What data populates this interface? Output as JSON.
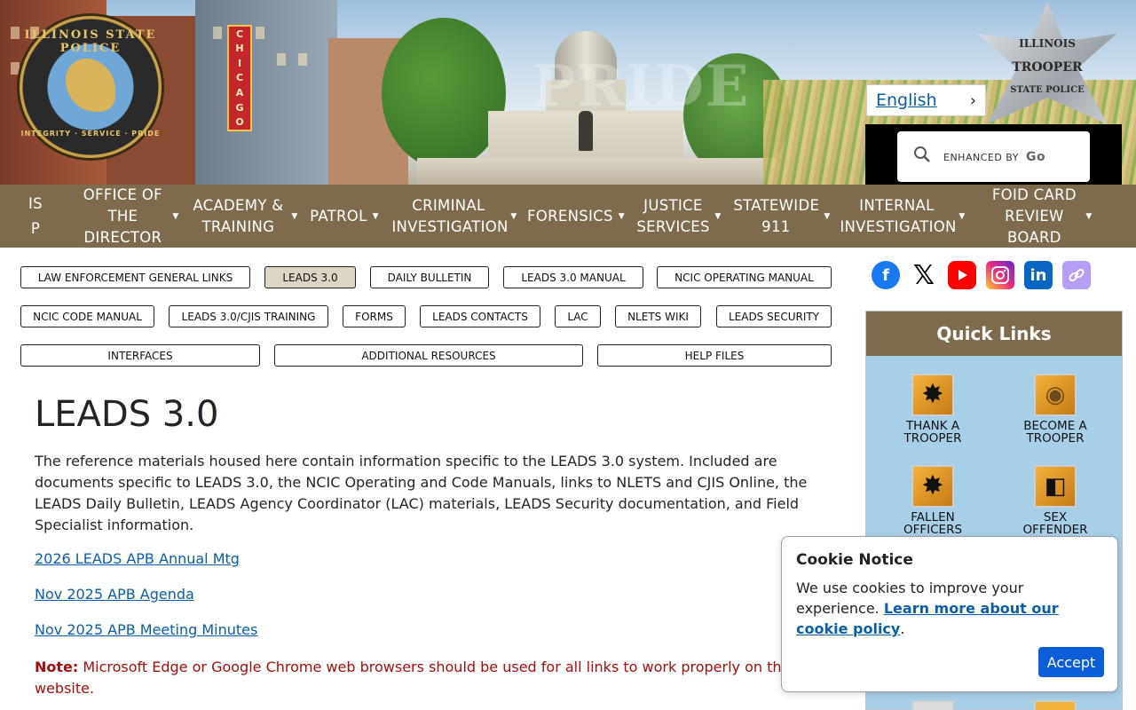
{
  "header": {
    "seal_top_text": "ILLINOIS STATE POLICE",
    "seal_bottom_text": "INTEGRITY · SERVICE · PRIDE",
    "marquee_text": "CHICAGO",
    "watermark_text": "PRIDE",
    "badge_lines": [
      "ILLINOIS",
      "TROOPER",
      "STATE POLICE"
    ],
    "language": {
      "label": "English",
      "icon": "chevron-right-icon"
    },
    "search": {
      "placeholder_prefix": "ENHANCED BY",
      "placeholder_brand": "Go",
      "icon": "search-icon"
    }
  },
  "nav": {
    "items": [
      {
        "label": "ISP",
        "display": "IS\nP",
        "has_caret": false
      },
      {
        "label": "OFFICE OF THE DIRECTOR",
        "has_caret": true
      },
      {
        "label": "ACADEMY & TRAINING",
        "has_caret": true
      },
      {
        "label": "PATROL",
        "has_caret": true
      },
      {
        "label": "CRIMINAL INVESTIGATION",
        "has_caret": true
      },
      {
        "label": "FORENSICS",
        "has_caret": true
      },
      {
        "label": "JUSTICE SERVICES",
        "has_caret": true
      },
      {
        "label": "STATEWIDE 911",
        "has_caret": true
      },
      {
        "label": "INTERNAL INVESTIGATION",
        "has_caret": true
      },
      {
        "label": "FOID CARD REVIEW BOARD",
        "has_caret": true
      }
    ]
  },
  "subnav": {
    "buttons": [
      "LAW ENFORCEMENT GENERAL LINKS",
      "LEADS 3.0",
      "DAILY BULLETIN",
      "LEADS 3.0 MANUAL",
      "NCIC OPERATING MANUAL",
      "NCIC CODE MANUAL",
      "LEADS 3.0/CJIS TRAINING",
      "FORMS",
      "LEADS CONTACTS",
      "LAC",
      "NLETS WIKI",
      "LEADS SECURITY",
      "INTERFACES",
      "ADDITIONAL RESOURCES",
      "HELP FILES"
    ],
    "active": "LEADS 3.0"
  },
  "main": {
    "title": "LEADS 3.0",
    "intro": "The reference materials housed here contain information specific to the LEADS 3.0 system. Included are documents specific to LEADS 3.0, the NCIC Operating and Code Manuals, links to NLETS and CJIS Online, the LEADS Daily Bulletin, LEADS Agency Coordinator (LAC) materials, LEADS Security documentation, and Field Specialist information.",
    "links": [
      "2026 LEADS APB Annual Mtg",
      "Nov 2025 APB Agenda",
      "Nov 2025 APB Meeting Minutes"
    ],
    "note_label": "Note:",
    "note_text": " Microsoft Edge or Google Chrome web browsers should be used for all links to work properly on this website."
  },
  "sidebar": {
    "social": [
      "facebook-icon",
      "x-icon",
      "youtube-icon",
      "instagram-icon",
      "linkedin-icon",
      "link-icon"
    ],
    "quick_links_title": "Quick Links",
    "tiles": [
      {
        "line1": "THANK A",
        "line2": "TROOPER",
        "icon": "star-badge-icon"
      },
      {
        "line1": "BECOME A",
        "line2": "TROOPER",
        "icon": "trooper-hat-icon"
      },
      {
        "line1": "FALLEN",
        "line2": "OFFICERS",
        "icon": "mourning-star-icon"
      },
      {
        "line1": "SEX",
        "line2": "OFFENDER",
        "icon": "offender-icon"
      }
    ]
  },
  "cookie": {
    "title": "Cookie Notice",
    "text": "We use cookies to improve your experience.",
    "link": "Learn more about our cookie policy",
    "after_link": ".",
    "accept": "Accept"
  },
  "colors": {
    "nav_bg": "#7e6b4e",
    "link": "#0b5ea8",
    "note": "#a50e0e",
    "quick_links_bg": "#a8cfe8",
    "accept_bg": "#0b5ed7",
    "active_pill": "#ddd5c3"
  }
}
